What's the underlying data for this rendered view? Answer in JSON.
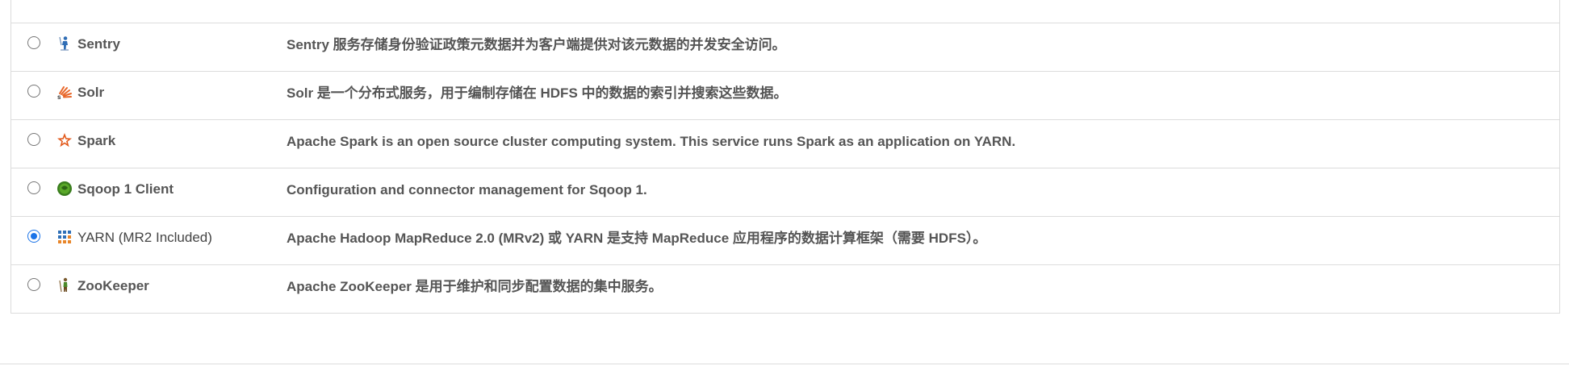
{
  "services": [
    {
      "name": "",
      "icon": "cutoff-row",
      "description": "",
      "selected": false
    },
    {
      "name": "Sentry",
      "icon": "sentry-icon",
      "description": "Sentry 服务存储身份验证政策元数据并为客户端提供对该元数据的并发安全访问。",
      "selected": false
    },
    {
      "name": "Solr",
      "icon": "solr-icon",
      "description": "Solr 是一个分布式服务，用于编制存储在 HDFS 中的数据的索引并搜索这些数据。",
      "selected": false
    },
    {
      "name": "Spark",
      "icon": "spark-icon",
      "description": "Apache Spark is an open source cluster computing system. This service runs Spark as an application on YARN.",
      "selected": false
    },
    {
      "name": "Sqoop 1 Client",
      "icon": "sqoop-icon",
      "description": "Configuration and connector management for Sqoop 1.",
      "selected": false
    },
    {
      "name": "YARN (MR2 Included)",
      "icon": "yarn-icon",
      "description": "Apache Hadoop MapReduce 2.0 (MRv2) 或 YARN 是支持 MapReduce 应用程序的数据计算框架（需要 HDFS）。",
      "selected": true
    },
    {
      "name": "ZooKeeper",
      "icon": "zookeeper-icon",
      "description": "Apache ZooKeeper 是用于维护和同步配置数据的集中服务。",
      "selected": false
    }
  ],
  "colors": {
    "border": "#dcdcdc",
    "text": "#555555",
    "radio_checked": "#1a73e8"
  }
}
